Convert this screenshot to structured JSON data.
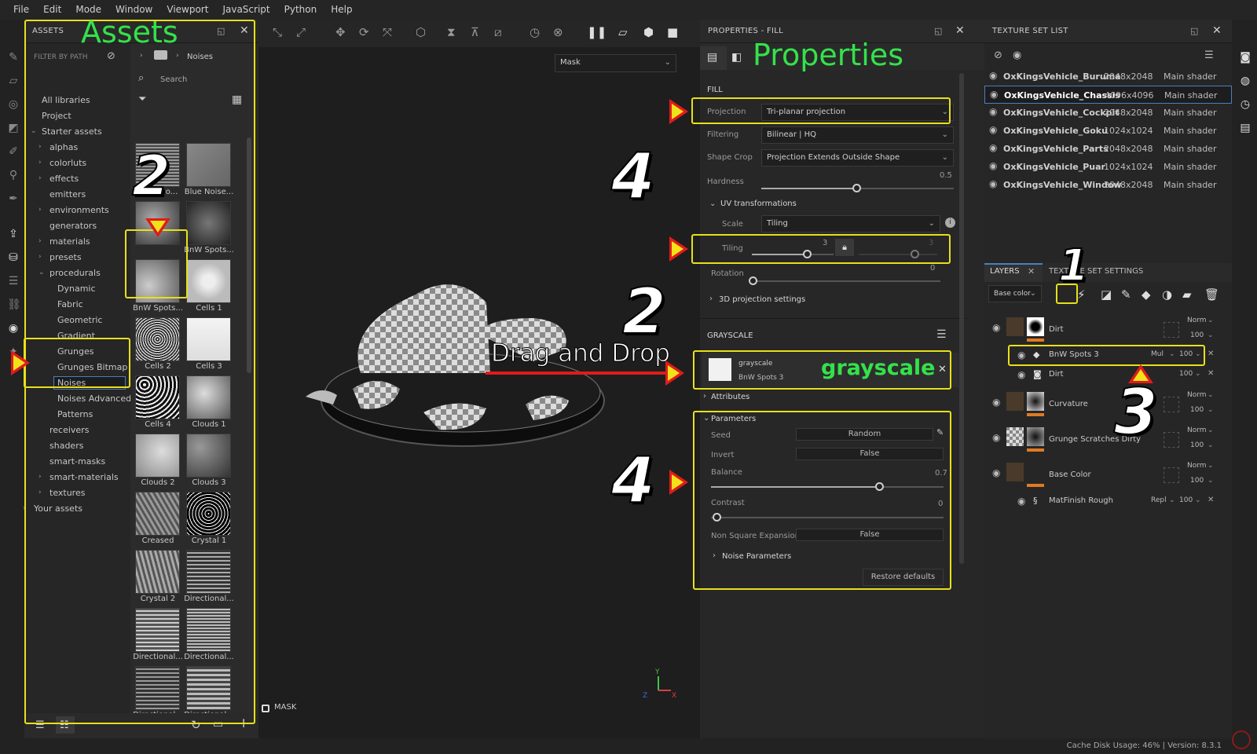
{
  "menubar": {
    "items": [
      "File",
      "Edit",
      "Mode",
      "Window",
      "Viewport",
      "JavaScript",
      "Python",
      "Help"
    ]
  },
  "assets": {
    "panel_title": "ASSETS",
    "filter_label": "FILTER BY PATH",
    "breadcrumb": "Noises",
    "search_placeholder": "Search",
    "tree": [
      "All libraries",
      "Project",
      "Starter assets",
      "alphas",
      "colorluts",
      "effects",
      "emitters",
      "environments",
      "generators",
      "materials",
      "presets",
      "procedurals",
      "Dynamic",
      "Fabric",
      "Geometric",
      "Gradient",
      "Grunges",
      "Grunges Bitmap",
      "Noises",
      "Noises Advanced",
      "Patterns",
      "receivers",
      "shaders",
      "smart-masks",
      "smart-materials",
      "textures",
      "Your assets"
    ],
    "thumbnails": [
      "Anisotro...",
      "Blue Noise...",
      "",
      "BnW Spots...",
      "BnW Spots...",
      "Cells 1",
      "Cells 2",
      "Cells 3",
      "Cells 4",
      "Clouds 1",
      "Clouds 2",
      "Clouds 3",
      "Creased",
      "Crystal 1",
      "Crystal 2",
      "Directional...",
      "Directional...",
      "Directional...",
      "Directional...",
      "Directional..."
    ]
  },
  "viewport": {
    "mode_dropdown": "Mask",
    "bottom_label": "MASK",
    "axis_x": "X",
    "axis_y": "Y",
    "axis_z": "Z"
  },
  "properties": {
    "panel_title": "PROPERTIES - FILL",
    "fill_section": "FILL",
    "projection_label": "Projection",
    "projection_value": "Tri-planar projection",
    "filtering_label": "Filtering",
    "filtering_value": "Bilinear | HQ",
    "shapecrop_label": "Shape Crop",
    "shapecrop_value": "Projection Extends Outside Shape",
    "hardness_label": "Hardness",
    "hardness_value": "0.5",
    "uv_section": "UV transformations",
    "scale_label": "Scale",
    "scale_value": "Tiling",
    "tiling_label": "Tiling",
    "tiling_value": "3",
    "tiling_value2": "3",
    "rotation_label": "Rotation",
    "rotation_value": "0",
    "proj3d_section": "3D projection settings",
    "grayscale_section": "GRAYSCALE",
    "grayscale_slot_title": "grayscale",
    "grayscale_slot_name": "BnW Spots 3",
    "attributes_section": "Attributes",
    "parameters_section": "Parameters",
    "seed_label": "Seed",
    "seed_value": "Random",
    "invert_label": "Invert",
    "invert_value": "False",
    "balance_label": "Balance",
    "balance_value": "0.7",
    "contrast_label": "Contrast",
    "contrast_value": "0",
    "nse_label": "Non Square Expansion",
    "nse_value": "False",
    "noise_params_section": "Noise Parameters",
    "restore_button": "Restore defaults"
  },
  "texture_set_list": {
    "panel_title": "TEXTURE SET LIST",
    "rows": [
      {
        "name": "OxKingsVehicle_Buruma",
        "size": "2048x2048",
        "shader": "Main shader"
      },
      {
        "name": "OxKingsVehicle_Chassis",
        "size": "4096x4096",
        "shader": "Main shader"
      },
      {
        "name": "OxKingsVehicle_Cockpit",
        "size": "2048x2048",
        "shader": "Main shader"
      },
      {
        "name": "OxKingsVehicle_Goku",
        "size": "1024x1024",
        "shader": "Main shader"
      },
      {
        "name": "OxKingsVehicle_Parts",
        "size": "2048x2048",
        "shader": "Main shader"
      },
      {
        "name": "OxKingsVehicle_Puar",
        "size": "1024x1024",
        "shader": "Main shader"
      },
      {
        "name": "OxKingsVehicle_Window",
        "size": "2048x2048",
        "shader": "Main shader"
      }
    ]
  },
  "layers": {
    "tab_layers": "LAYERS",
    "tab_settings": "TEXTURE SET SETTINGS",
    "channel": "Base color",
    "rows": [
      {
        "name": "Dirt",
        "blend": "Norm",
        "opacity": "100"
      },
      {
        "name": "BnW Spots 3",
        "blend": "Mul",
        "opacity": "100"
      },
      {
        "name": "Dirt",
        "blend": "",
        "opacity": "100"
      },
      {
        "name": "Curvature",
        "blend": "Norm",
        "opacity": "100"
      },
      {
        "name": "Grunge Scratches Dirty",
        "blend": "Norm",
        "opacity": "100"
      },
      {
        "name": "Base Color",
        "blend": "Norm",
        "opacity": "100"
      },
      {
        "name": "MatFinish Rough",
        "blend": "Repl",
        "opacity": "100"
      }
    ]
  },
  "annotations": {
    "assets_title": "Assets",
    "properties_title": "Properties",
    "grayscale_title": "grayscale",
    "drag_drop": "Drag and Drop",
    "n1": "1",
    "n2a": "2",
    "n2b": "2",
    "n3": "3",
    "n4a": "4",
    "n4b": "4",
    "highlight_color": "#e8e01a",
    "arrow_color": "#e01b1b",
    "title_color": "#34e24a"
  },
  "statusbar": {
    "text": "Cache Disk Usage:  46% | Version: 8.3.1"
  }
}
